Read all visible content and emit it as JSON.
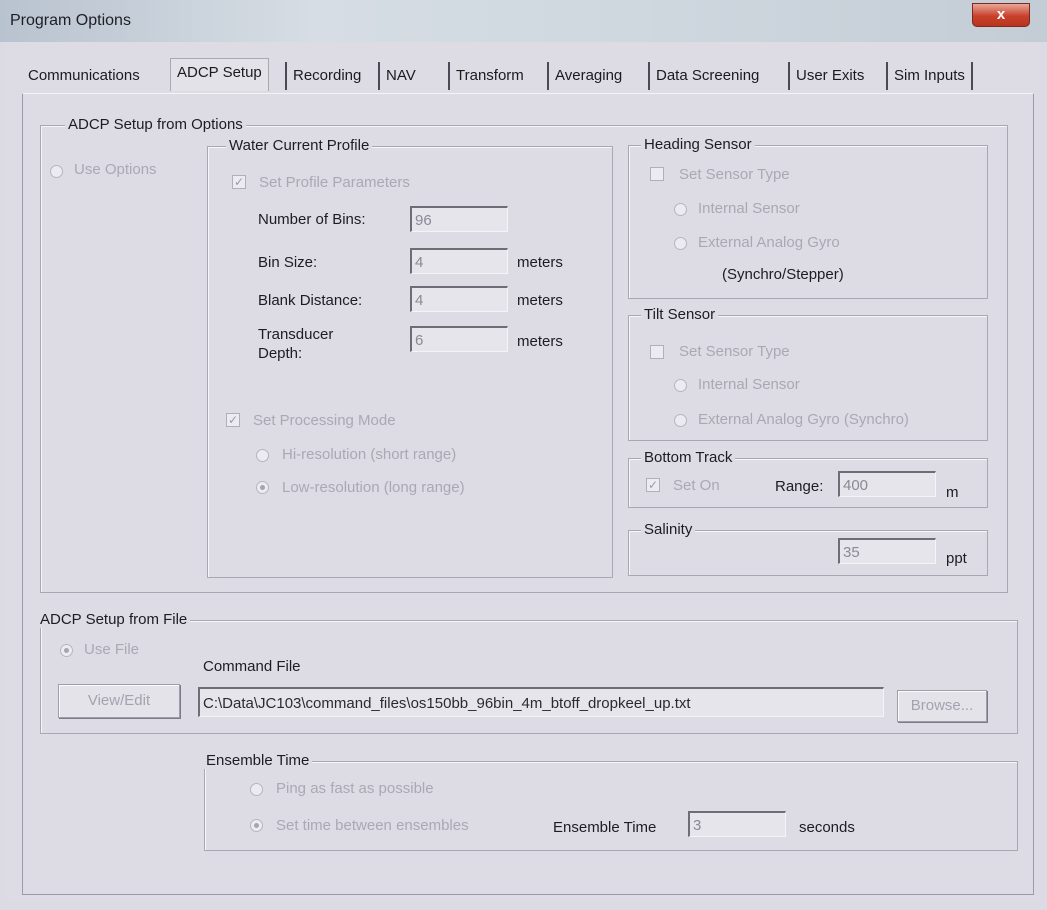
{
  "window": {
    "title": "Program Options",
    "close_label": "x"
  },
  "tabs": [
    "Communications",
    "ADCP Setup",
    "Recording",
    "NAV",
    "Transform",
    "Averaging",
    "Data Screening",
    "User Exits",
    "Sim Inputs"
  ],
  "from_options": {
    "legend": "ADCP Setup from Options",
    "use_options": "Use Options",
    "water_profile": {
      "legend": "Water Current Profile",
      "set_profile": "Set Profile Parameters",
      "num_bins_label": "Number of Bins:",
      "num_bins": "96",
      "bin_size_label": "Bin Size:",
      "bin_size": "4",
      "bin_size_unit": "meters",
      "blank_label": "Blank Distance:",
      "blank": "4",
      "blank_unit": "meters",
      "transducer_label_1": "Transducer",
      "transducer_label_2": "Depth:",
      "transducer": "6",
      "transducer_unit": "meters",
      "set_processing": "Set Processing Mode",
      "hi_res": "Hi-resolution (short range)",
      "low_res": "Low-resolution (long range)"
    },
    "heading": {
      "legend": "Heading Sensor",
      "set_type": "Set Sensor Type",
      "internal": "Internal Sensor",
      "external": "External Analog Gyro",
      "external_sub": "(Synchro/Stepper)"
    },
    "tilt": {
      "legend": "Tilt Sensor",
      "set_type": "Set Sensor Type",
      "internal": "Internal Sensor",
      "external": "External Analog Gyro (Synchro)"
    },
    "bottom_track": {
      "legend": "Bottom Track",
      "set_on": "Set On",
      "range_label": "Range:",
      "range": "400",
      "range_unit": "m"
    },
    "salinity": {
      "legend": "Salinity",
      "value": "35",
      "unit": "ppt"
    }
  },
  "from_file": {
    "legend": "ADCP Setup from File",
    "use_file": "Use File",
    "command_file_label": "Command File",
    "command_file": "C:\\Data\\JC103\\command_files\\os150bb_96bin_4m_btoff_dropkeel_up.txt",
    "view_edit": "View/Edit",
    "browse": "Browse..."
  },
  "ensemble": {
    "legend": "Ensemble Time",
    "ping_fast": "Ping as fast as possible",
    "set_time": "Set time between ensembles",
    "time_label": "Ensemble Time",
    "time": "3",
    "time_unit": "seconds"
  }
}
